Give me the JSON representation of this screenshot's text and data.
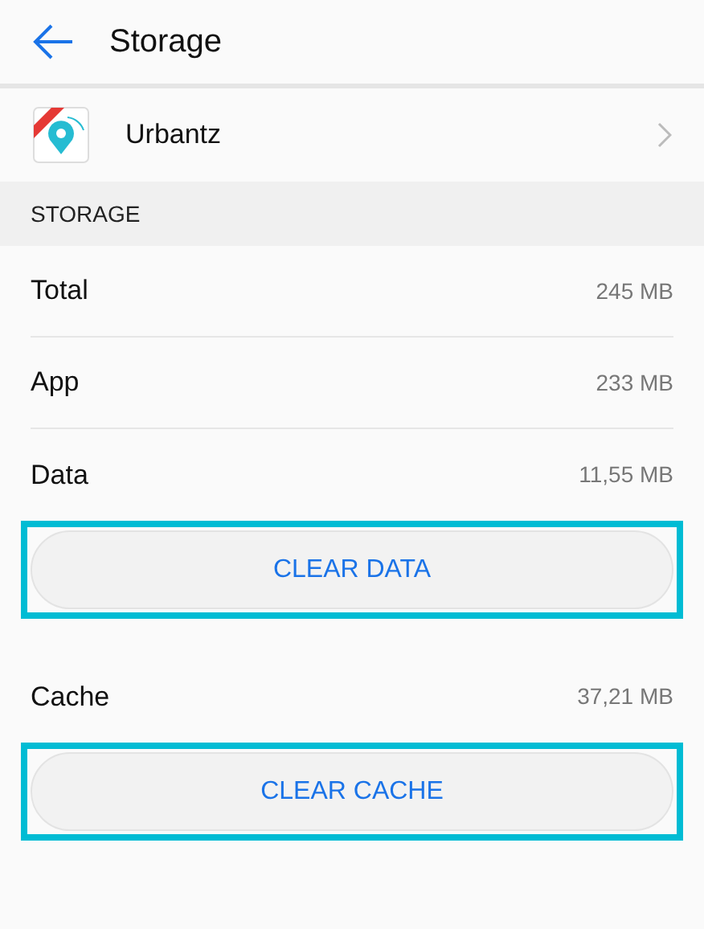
{
  "header": {
    "title": "Storage"
  },
  "app": {
    "name": "Urbantz"
  },
  "section": {
    "title": "STORAGE"
  },
  "items": [
    {
      "kind": "row",
      "label": "Total",
      "value": "245 MB"
    },
    {
      "kind": "row",
      "label": "App",
      "value": "233 MB"
    },
    {
      "kind": "row",
      "label": "Data",
      "value": "11,55 MB"
    },
    {
      "kind": "button",
      "label": "CLEAR DATA",
      "highlighted": true
    },
    {
      "kind": "row",
      "label": "Cache",
      "value": "37,21 MB"
    },
    {
      "kind": "button",
      "label": "CLEAR CACHE",
      "highlighted": true
    }
  ]
}
